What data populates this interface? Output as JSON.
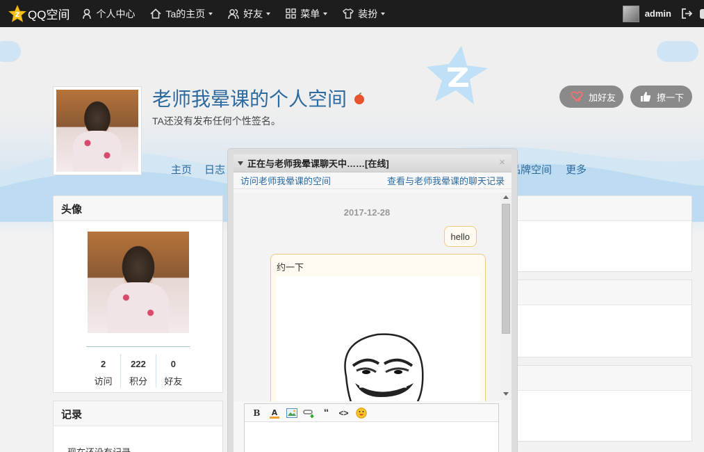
{
  "topbar": {
    "logo_text": "QQ空间",
    "nav": [
      {
        "label": "个人中心"
      },
      {
        "label": "Ta的主页"
      },
      {
        "label": "好友"
      },
      {
        "label": "菜单"
      },
      {
        "label": "装扮"
      }
    ],
    "username": "admin"
  },
  "profile": {
    "title": "老师我晕课的个人空间",
    "signature": "TA还没有发布任何个性签名。",
    "add_friend_label": "加好友",
    "poke_label": "撩一下"
  },
  "tabs": [
    {
      "label": "主页"
    },
    {
      "label": "日志"
    },
    {
      "label": "品牌空间"
    },
    {
      "label": "更多"
    }
  ],
  "avatar_panel": {
    "heading": "头像",
    "stats": [
      {
        "value": "2",
        "label": "访问"
      },
      {
        "value": "222",
        "label": "积分"
      },
      {
        "value": "0",
        "label": "好友"
      }
    ]
  },
  "record_panel": {
    "heading": "记录",
    "empty_text": "现在还没有记录"
  },
  "chat": {
    "title": "正在与老师我晕课聊天中……[在线]",
    "visit_link": "访问老师我晕课的空间",
    "history_link": "查看与老师我晕课的聊天记录",
    "date": "2017-12-28",
    "my_message": "hello",
    "their_message": "约一下",
    "toolbar": {
      "bold": "B",
      "quote": "“",
      "code": "<>"
    }
  },
  "colors": {
    "topbar_bg": "#1d1d1d",
    "link_blue": "#2d6aa0",
    "bubble_border": "#f0c98a"
  }
}
